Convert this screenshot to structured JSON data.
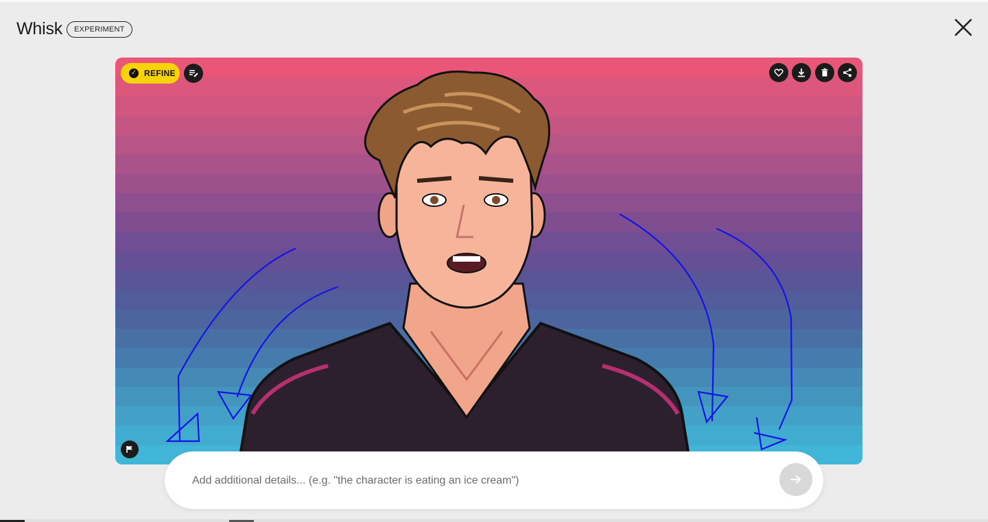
{
  "header": {
    "title": "Whisk",
    "badge": "EXPERIMENT"
  },
  "image_toolbar": {
    "refine_label": "REFINE",
    "icons": [
      "check-circle-icon",
      "edit-notes-icon",
      "heart-icon",
      "download-icon",
      "trash-icon",
      "share-icon",
      "flag-icon"
    ]
  },
  "prompt": {
    "placeholder": "Add additional details... (e.g. \"the character is eating an ice cream\")",
    "value": ""
  },
  "colors": {
    "background": "#ececec",
    "refine_yellow": "#f9d30a",
    "icon_button": "#1b1b1b",
    "annotation_blue": "#1414e6",
    "gradient_top": "#e8567a",
    "gradient_mid": "#6a4c94",
    "gradient_bottom": "#44b8dc"
  }
}
